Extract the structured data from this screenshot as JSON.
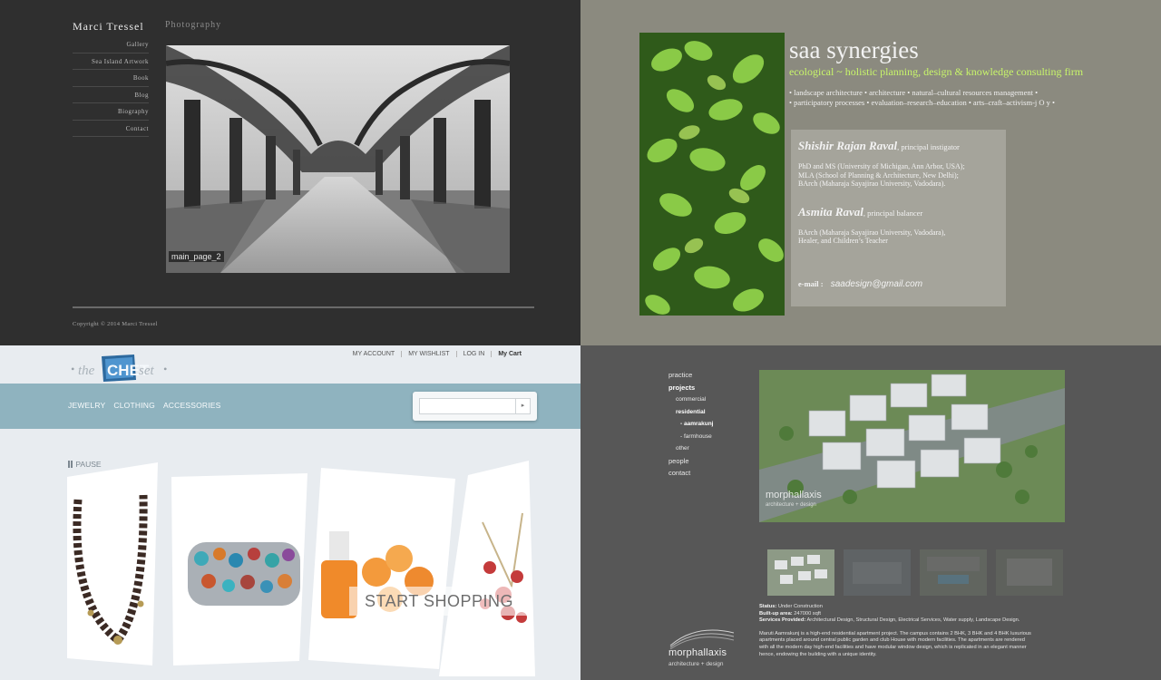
{
  "marci": {
    "brand": "Marci Tressel",
    "section_title": "Photography",
    "nav": [
      "Gallery",
      "Sea Island Artwork",
      "Book",
      "Blog",
      "Biography",
      "Contact"
    ],
    "photo_caption": "main_page_2",
    "copyright": "Copyright © 2014 Marci Tressel"
  },
  "saa": {
    "title": "saa synergies",
    "tagline": "ecological ~ holistic planning, design & knowledge consulting firm",
    "services_line1": "• landscape architecture • architecture • natural–cultural resources management •",
    "services_line2": "• participatory processes • evaluation–research–education • arts–craft–activism-j O y •",
    "person1_name": "Shishir Rajan Raval",
    "person1_role": ", principal instigator",
    "person1_qual1": "PhD and MS (University of Michigan, Ann Arbor, USA);",
    "person1_qual2": "MLA (School of Planning & Architecture, New Delhi);",
    "person1_qual3": "BArch (Maharaja Sayajirao University, Vadodara).",
    "person2_name": "Asmita Raval",
    "person2_role": ", principal balancer",
    "person2_qual1": "BArch (Maharaja Sayajirao University, Vadodara),",
    "person2_qual2": "Healer, and Children’s Teacher",
    "email_label": "e-mail :",
    "email": "saadesign@gmail.com"
  },
  "chet": {
    "util_links": [
      "MY ACCOUNT",
      "MY WISHLIST",
      "LOG IN",
      "My Cart"
    ],
    "nav": [
      "JEWELRY",
      "CLOTHING",
      "ACCESSORIES"
    ],
    "search_value": "",
    "search_button": "▸",
    "pause_label": "PAUSE",
    "cta": "START SHOPPING"
  },
  "morph": {
    "nav_practice": "practice",
    "nav_projects": "projects",
    "nav_commercial": "commercial",
    "nav_residential": "residential",
    "nav_aamrakunj": "- aamrakunj",
    "nav_farmhouse": "- farmhouse",
    "nav_other": "other",
    "nav_people": "people",
    "nav_contact": "contact",
    "hero_brand": "morphallaxis",
    "hero_sub": "architecture + design",
    "status_label": "Status:",
    "status": "Under Construction",
    "builtup_label": "Built-up area:",
    "builtup": "247000 sqft",
    "services_label": "Services Provided:",
    "services": "Architectural Design, Structural Design, Electrical Services, Water supply, Landscape Design.",
    "description": "Maruti Aamrakunj is a high-end residential apartment project. The campus contains 2 BHK, 3 BHK and 4 BHK luxurious apartments placed around central public garden and club House with modern facilities. The apartments are rendered with all the modern day high-end facilities and have modular window design, which is replicated in an elegant manner hence, endowing the building with a unique identity.",
    "logo_text": "morphallaxis",
    "logo_sub": "architecture + design"
  },
  "colors": {
    "saa_accent": "#c8f56a",
    "chet_bar": "#8fb3bf"
  }
}
